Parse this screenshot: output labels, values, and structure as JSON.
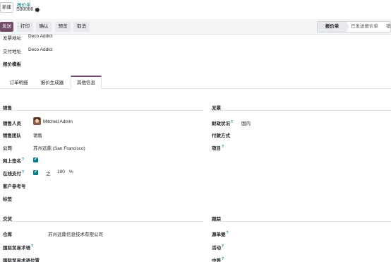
{
  "header": {
    "new_button": "新建",
    "breadcrumb_parent": "报价单",
    "record_name": "S00066",
    "settings_icon": "gear-icon"
  },
  "actions": {
    "send": "发送",
    "print": "打印",
    "confirm": "确认",
    "preview": "预览",
    "cancel": "取消"
  },
  "status": {
    "active": "报价单",
    "next": "已发送报价单",
    "third": "销"
  },
  "top_fields": {
    "invoice_address_label": "发票地址",
    "invoice_address_value": "Deco Addict",
    "delivery_address_label": "交付地址",
    "delivery_address_value": "Deco Addict",
    "quote_template_label": "报价模板"
  },
  "tabs": {
    "order_lines": "订单明细",
    "quote_builder": "报价生成器",
    "other_info": "其他信息"
  },
  "sales": {
    "title": "销售",
    "salesperson_label": "销售人员",
    "salesperson_value": "Mitchell Admin",
    "team_label": "销售团队",
    "team_value": "销售",
    "company_label": "公司",
    "company_value": "苏州远鼎 (San Francisco)",
    "online_sign_label": "网上签名",
    "online_pay_label": "在线支付",
    "online_pay_of": "之",
    "online_pay_percent": "100",
    "percent_sign": "%",
    "customer_ref_label": "客户参考号",
    "tags_label": "标签"
  },
  "invoicing": {
    "title": "发票",
    "fiscal_label": "财政状况",
    "fiscal_value": "国内",
    "payment_terms_label": "付款方式",
    "project_label": "项目"
  },
  "delivery": {
    "title": "交货",
    "warehouse_label": "仓库",
    "warehouse_value": "苏州远鼎信息技术有限公司",
    "incoterm_label": "国际贸易术语",
    "incoterm_location_label": "国际贸易术语位置"
  },
  "tracking": {
    "title": "跟踪",
    "source_doc_label": "源单据",
    "campaign_label": "活动",
    "medium_label": "中等"
  },
  "help_mark": "?",
  "check_mark": "✔",
  "colors": {
    "brand": "#714b67",
    "accent": "#017e84"
  }
}
